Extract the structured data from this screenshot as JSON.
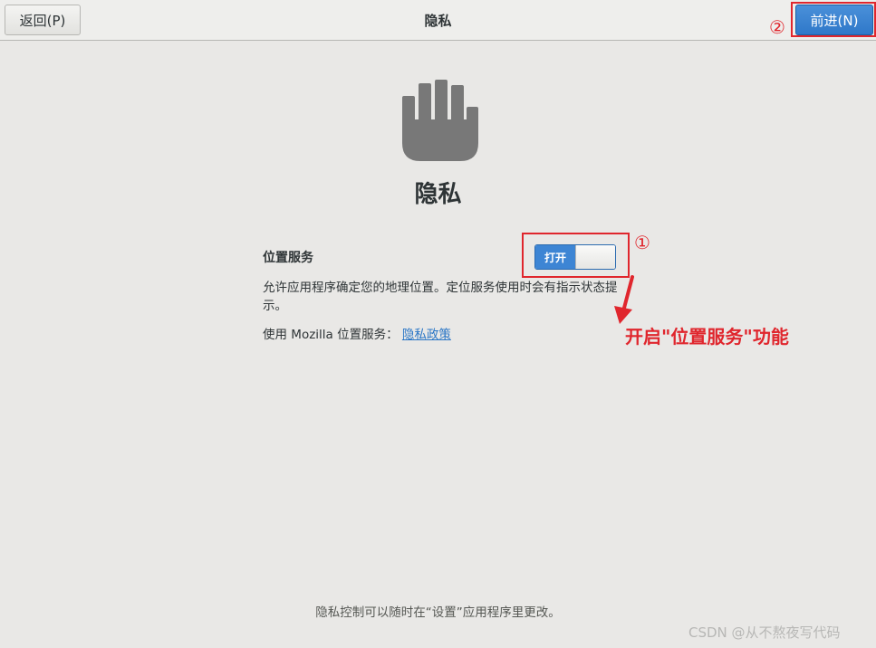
{
  "header": {
    "back_label": "返回(P)",
    "title": "隐私",
    "next_label": "前进(N)"
  },
  "page": {
    "title": "隐私",
    "icon": "hand-stop-icon"
  },
  "location": {
    "label": "位置服务",
    "switch_state": "打开",
    "description": "允许应用程序确定您的地理位置。定位服务使用时会有指示状态提示。",
    "mozilla_prefix": "使用 Mozilla 位置服务：",
    "privacy_link": "隐私政策"
  },
  "footer": {
    "note": "隐私控制可以随时在“设置”应用程序里更改。"
  },
  "annotations": {
    "marker_1": "①",
    "marker_2": "②",
    "callout": "开启\"位置服务\"功能"
  },
  "watermark": "CSDN @从不熬夜写代码",
  "colors": {
    "accent": "#3d85d4",
    "annotation_red": "#e0262d",
    "background": "#e9e8e6"
  }
}
